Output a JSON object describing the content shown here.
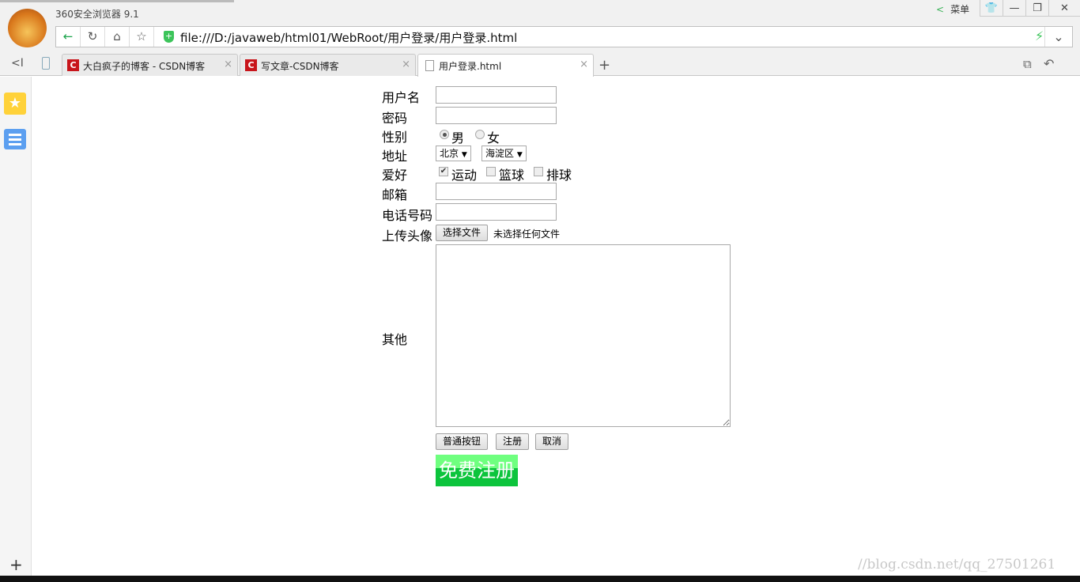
{
  "browser": {
    "title": "360安全浏览器 9.1",
    "menu_label": "菜单",
    "url": "file:///D:/javaweb/html01/WebRoot/用户登录/用户登录.html",
    "tabs": [
      {
        "label": "大白疯子的博客 - CSDN博客",
        "icon": "csdn-icon"
      },
      {
        "label": "写文章-CSDN博客",
        "icon": "csdn-icon"
      },
      {
        "label": "用户登录.html",
        "icon": "document-icon",
        "active": true
      }
    ]
  },
  "form": {
    "username_label": "用户名",
    "password_label": "密码",
    "gender_label": "性别",
    "gender_options": [
      "男",
      "女"
    ],
    "gender_selected": "男",
    "address_label": "地址",
    "city": "北京",
    "district": "海淀区",
    "hobby_label": "爱好",
    "hobbies": [
      {
        "label": "运动",
        "checked": true
      },
      {
        "label": "篮球",
        "checked": false
      },
      {
        "label": "排球",
        "checked": false
      }
    ],
    "email_label": "邮箱",
    "phone_label": "电话号码",
    "avatar_label": "上传头像",
    "file_button": "选择文件",
    "file_status": "未选择任何文件",
    "other_label": "其他",
    "buttons": [
      "普通按钮",
      "注册",
      "取消"
    ],
    "image_button": "免费注册"
  },
  "watermark": "//blog.csdn.net/qq_27501261",
  "colors": {
    "accent_green": "#0cc43c",
    "csdn_red": "#c8151b"
  }
}
